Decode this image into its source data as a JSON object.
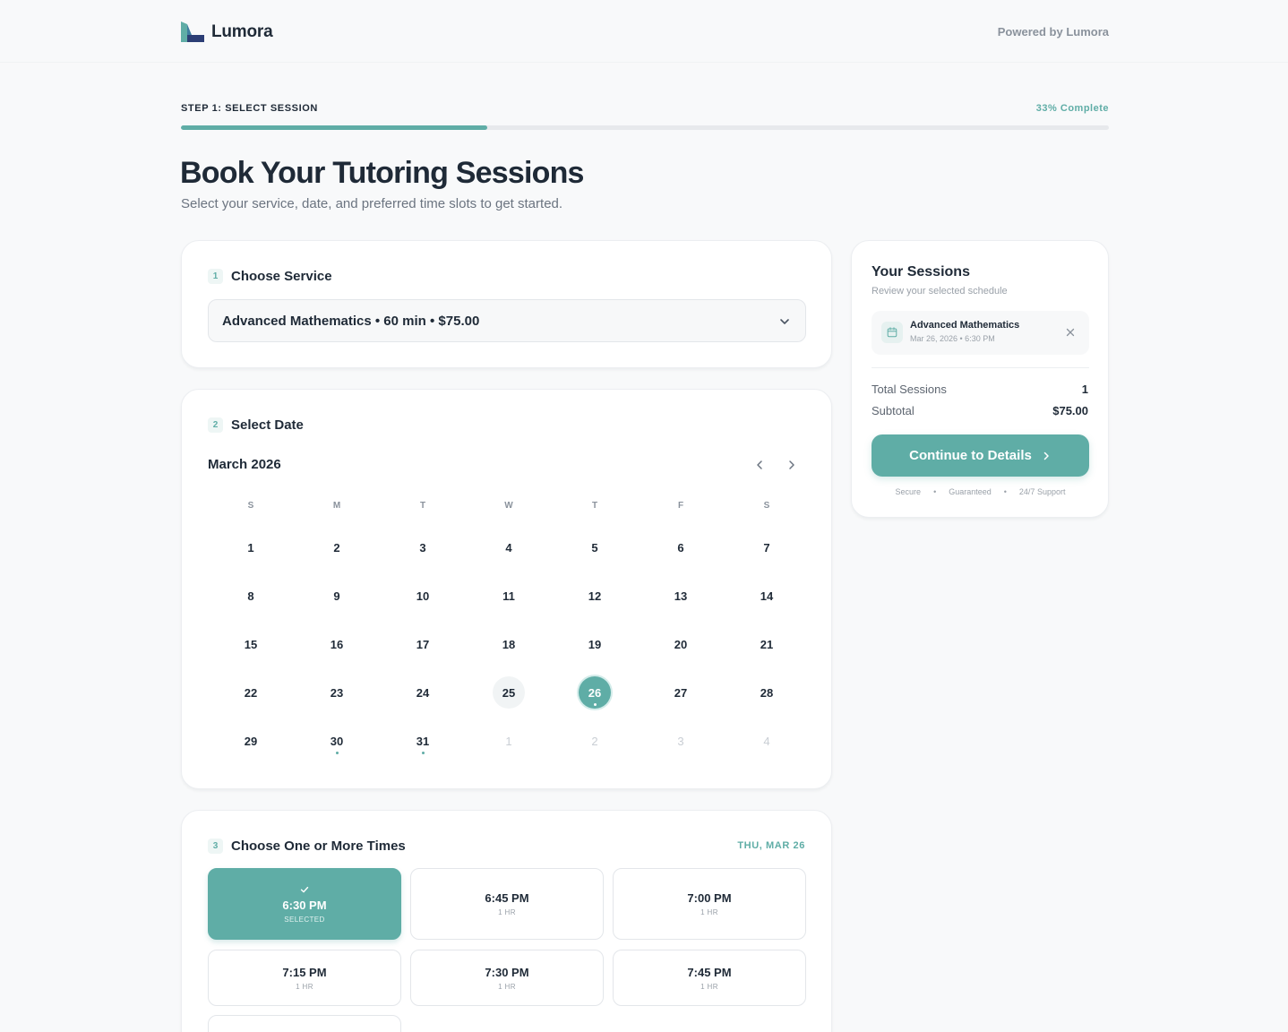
{
  "brand": {
    "name": "Lumora",
    "powered_by": "Powered by Lumora",
    "accent": "#5fada6"
  },
  "progress": {
    "step_label": "STEP 1: SELECT SESSION",
    "percent_label": "33% Complete",
    "percent": 33
  },
  "page": {
    "title": "Book Your Tutoring Sessions",
    "subtitle": "Select your service, date, and preferred time slots to get started."
  },
  "service": {
    "number": "1",
    "title": "Choose Service",
    "selected": "Advanced Mathematics • 60 min • $75.00"
  },
  "date": {
    "number": "2",
    "title": "Select Date",
    "month": "March 2026",
    "weekdays": [
      "S",
      "M",
      "T",
      "W",
      "T",
      "F",
      "S"
    ],
    "days": [
      {
        "label": "1"
      },
      {
        "label": "2"
      },
      {
        "label": "3"
      },
      {
        "label": "4"
      },
      {
        "label": "5"
      },
      {
        "label": "6"
      },
      {
        "label": "7"
      },
      {
        "label": "8"
      },
      {
        "label": "9"
      },
      {
        "label": "10"
      },
      {
        "label": "11"
      },
      {
        "label": "12"
      },
      {
        "label": "13"
      },
      {
        "label": "14"
      },
      {
        "label": "15"
      },
      {
        "label": "16"
      },
      {
        "label": "17"
      },
      {
        "label": "18"
      },
      {
        "label": "19"
      },
      {
        "label": "20"
      },
      {
        "label": "21"
      },
      {
        "label": "22"
      },
      {
        "label": "23"
      },
      {
        "label": "24"
      },
      {
        "label": "25",
        "today": true
      },
      {
        "label": "26",
        "selected": true,
        "dot": true
      },
      {
        "label": "27"
      },
      {
        "label": "28"
      },
      {
        "label": "29"
      },
      {
        "label": "30",
        "dot": true
      },
      {
        "label": "31",
        "dot": true
      },
      {
        "label": "1",
        "muted": true
      },
      {
        "label": "2",
        "muted": true
      },
      {
        "label": "3",
        "muted": true
      },
      {
        "label": "4",
        "muted": true
      }
    ]
  },
  "times": {
    "number": "3",
    "title": "Choose One or More Times",
    "date_label": "THU, MAR 26",
    "slots": [
      {
        "time": "6:30 PM",
        "sub": "SELECTED",
        "selected": true
      },
      {
        "time": "6:45 PM",
        "sub": "1 HR"
      },
      {
        "time": "7:00 PM",
        "sub": "1 HR"
      },
      {
        "time": "7:15 PM",
        "sub": "1 HR"
      },
      {
        "time": "7:30 PM",
        "sub": "1 HR"
      },
      {
        "time": "7:45 PM",
        "sub": "1 HR"
      }
    ]
  },
  "summary": {
    "title": "Your Sessions",
    "subtitle": "Review your selected schedule",
    "item": {
      "name": "Advanced Mathematics",
      "when": "Mar 26, 2026 • 6:30 PM"
    },
    "total_label": "Total Sessions",
    "total_value": "1",
    "subtotal_label": "Subtotal",
    "subtotal_value": "$75.00",
    "button_label": "Continue to Details",
    "trust": [
      "Secure",
      "Guaranteed",
      "24/7 Support"
    ]
  },
  "icons": {
    "logo": "lumora-logo-icon",
    "select": "chevron-down-icon",
    "prev": "chevron-left-icon",
    "next": "chevron-right-icon",
    "check": "check-icon",
    "calendar": "calendar-icon",
    "remove": "close-icon",
    "button_arrow": "chevron-right-icon"
  }
}
